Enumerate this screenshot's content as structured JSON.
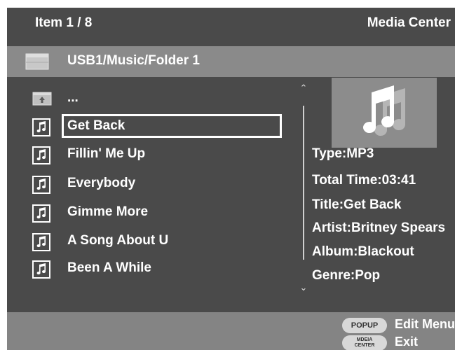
{
  "header": {
    "item_counter": "Item 1 / 8",
    "app_title": "Media Center"
  },
  "path": {
    "current_path": "USB1/Music/Folder 1",
    "icon": "folder-icon"
  },
  "file_list": {
    "items": [
      {
        "label": "...",
        "icon": "folder-up-icon",
        "selected": false
      },
      {
        "label": "Get Back",
        "icon": "music-note-icon",
        "selected": true
      },
      {
        "label": "Fillin' Me Up",
        "icon": "music-note-icon",
        "selected": false
      },
      {
        "label": "Everybody",
        "icon": "music-note-icon",
        "selected": false
      },
      {
        "label": "Gimme More",
        "icon": "music-note-icon",
        "selected": false
      },
      {
        "label": "A Song About U",
        "icon": "music-note-icon",
        "selected": false
      },
      {
        "label": "Been A While",
        "icon": "music-note-icon",
        "selected": false
      }
    ]
  },
  "details": {
    "type": "Type:MP3",
    "total_time": "Total Time:03:41",
    "title": "Title:Get Back",
    "artist": "Artist:Britney Spears",
    "album": "Album:Blackout",
    "genre": "Genre:Pop"
  },
  "footer": {
    "popup_key": "POPUP",
    "popup_action": "Edit Menu",
    "media_key_line1": "MDEIA",
    "media_key_line2": "CENTER",
    "media_action": "Exit"
  },
  "colors": {
    "background": "#4a4a4a",
    "path_bar": "#8a8a8a",
    "footer_bar": "#848484",
    "text": "#ffffff"
  }
}
